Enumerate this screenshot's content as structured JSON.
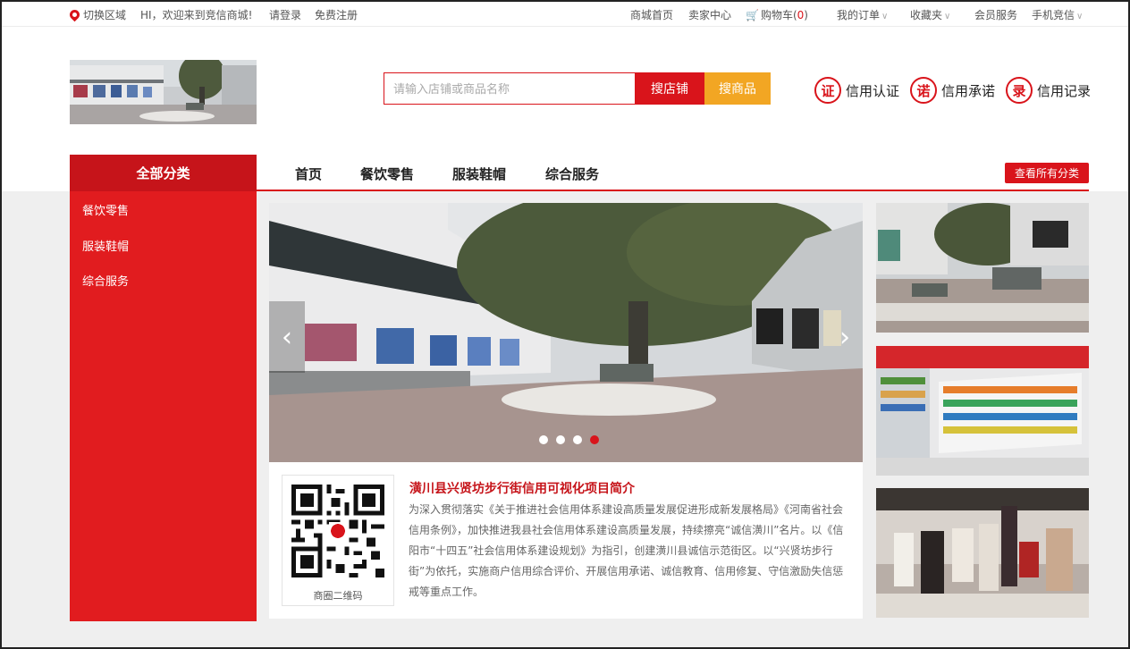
{
  "topbar": {
    "region": "切换区域",
    "welcome": "HI，欢迎来到竞信商城!",
    "login": "请登录",
    "register": "免费注册",
    "home": "商城首页",
    "seller": "卖家中心",
    "cart_label": "购物车(",
    "cart_count": "0",
    "cart_close": ")",
    "orders": "我的订单",
    "favorites": "收藏夹",
    "member": "会员服务",
    "mobile": "手机竞信"
  },
  "search": {
    "placeholder": "请输入店铺或商品名称",
    "shop_button": "搜店铺",
    "goods_button": "搜商品"
  },
  "credit": [
    {
      "badge": "证",
      "label": "信用认证"
    },
    {
      "badge": "诺",
      "label": "信用承诺"
    },
    {
      "badge": "录",
      "label": "信用记录"
    }
  ],
  "nav": {
    "all_categories": "全部分类",
    "items": [
      "首页",
      "餐饮零售",
      "服装鞋帽",
      "综合服务"
    ],
    "view_all": "查看所有分类"
  },
  "sidebar": {
    "items": [
      "餐饮零售",
      "服装鞋帽",
      "综合服务"
    ]
  },
  "carousel": {
    "slide_count": 4,
    "active_index": 3
  },
  "intro": {
    "title": "潢川县兴贤坊步行街信用可视化项目简介",
    "text": "为深入贯彻落实《关于推进社会信用体系建设高质量发展促进形成新发展格局》《河南省社会信用条例》，加快推进我县社会信用体系建设高质量发展，持续擦亮“诚信潢川”名片。以《信阳市“十四五”社会信用体系建设规划》为指引，创建潢川县诚信示范街区。以“兴贤坊步行街”为依托，实施商户信用综合评价、开展信用承诺、诚信教育、信用修复、守信激励失信惩戒等重点工作。",
    "qr_caption": "商圈二维码"
  },
  "colors": {
    "brand_red": "#d9141b",
    "dark_red": "#c6141a",
    "orange": "#f2a623"
  }
}
